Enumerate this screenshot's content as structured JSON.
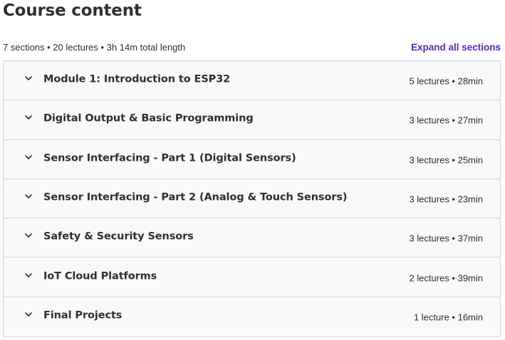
{
  "header": {
    "title": "Course content",
    "summary": "7 sections • 20 lectures • 3h 14m total length",
    "expand_label": "Expand all sections"
  },
  "colors": {
    "accent": "#5624d0",
    "section_bg": "#f7f9fa",
    "border": "#d1d7dc",
    "text": "#2d2f31"
  },
  "sections": [
    {
      "title": "Module 1: Introduction to ESP32",
      "meta": "5 lectures • 28min",
      "icon": "chevron-down-icon"
    },
    {
      "title": "Digital Output & Basic Programming",
      "meta": "3 lectures • 27min",
      "icon": "chevron-down-icon"
    },
    {
      "title": "Sensor Interfacing - Part 1 (Digital Sensors)",
      "meta": "3 lectures • 25min",
      "icon": "chevron-down-icon"
    },
    {
      "title": "Sensor Interfacing - Part 2 (Analog & Touch Sensors)",
      "meta": "3 lectures • 23min",
      "icon": "chevron-down-icon"
    },
    {
      "title": "Safety & Security Sensors",
      "meta": "3 lectures • 37min",
      "icon": "chevron-down-icon"
    },
    {
      "title": "IoT Cloud Platforms",
      "meta": "2 lectures • 39min",
      "icon": "chevron-down-icon"
    },
    {
      "title": "Final Projects",
      "meta": "1 lecture • 16min",
      "icon": "chevron-down-icon"
    }
  ]
}
